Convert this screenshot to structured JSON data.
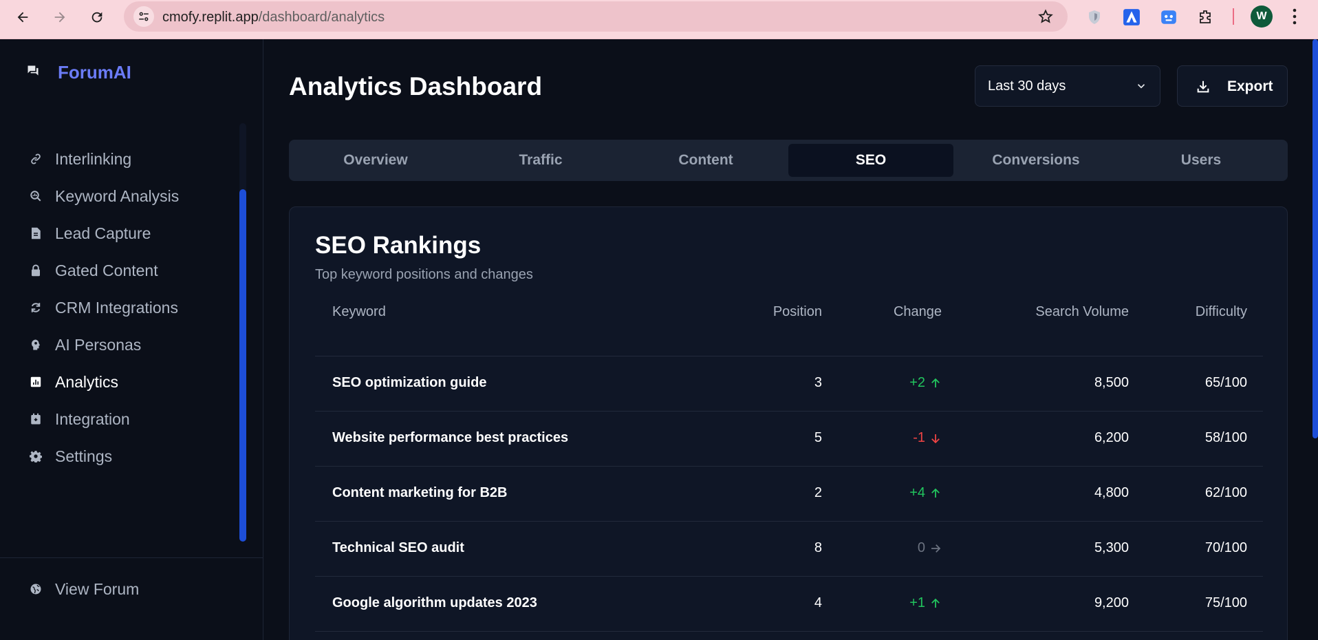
{
  "browser": {
    "url_host": "cmofy.replit.app",
    "url_path": "/dashboard/analytics",
    "profile_initial": "W"
  },
  "sidebar": {
    "brand": "ForumAI",
    "items": [
      {
        "label": "Interlinking",
        "icon": "link-icon"
      },
      {
        "label": "Keyword Analysis",
        "icon": "search-chart-icon"
      },
      {
        "label": "Lead Capture",
        "icon": "document-icon"
      },
      {
        "label": "Gated Content",
        "icon": "lock-icon"
      },
      {
        "label": "CRM Integrations",
        "icon": "sync-icon"
      },
      {
        "label": "AI Personas",
        "icon": "brain-icon"
      },
      {
        "label": "Analytics",
        "icon": "analytics-icon",
        "active": true
      },
      {
        "label": "Integration",
        "icon": "plug-icon"
      },
      {
        "label": "Settings",
        "icon": "gear-icon"
      }
    ],
    "footer": {
      "label": "View Forum",
      "icon": "globe-icon"
    }
  },
  "header": {
    "title": "Analytics Dashboard",
    "range": "Last 30 days",
    "export_label": "Export"
  },
  "tabs": [
    {
      "label": "Overview"
    },
    {
      "label": "Traffic"
    },
    {
      "label": "Content"
    },
    {
      "label": "SEO",
      "active": true
    },
    {
      "label": "Conversions"
    },
    {
      "label": "Users"
    }
  ],
  "seo": {
    "title": "SEO Rankings",
    "subtitle": "Top keyword positions and changes",
    "columns": [
      "Keyword",
      "Position",
      "Change",
      "Search Volume",
      "Difficulty"
    ],
    "rows": [
      {
        "keyword": "SEO optimization guide",
        "position": "3",
        "change": "+2",
        "trend": "up",
        "volume": "8,500",
        "difficulty": "65/100"
      },
      {
        "keyword": "Website performance best practices",
        "position": "5",
        "change": "-1",
        "trend": "down",
        "volume": "6,200",
        "difficulty": "58/100"
      },
      {
        "keyword": "Content marketing for B2B",
        "position": "2",
        "change": "+4",
        "trend": "up",
        "volume": "4,800",
        "difficulty": "62/100"
      },
      {
        "keyword": "Technical SEO audit",
        "position": "8",
        "change": "0",
        "trend": "flat",
        "volume": "5,300",
        "difficulty": "70/100"
      },
      {
        "keyword": "Google algorithm updates 2023",
        "position": "4",
        "change": "+1",
        "trend": "up",
        "volume": "9,200",
        "difficulty": "75/100"
      }
    ]
  },
  "colors": {
    "accent": "#6b7cf7",
    "positive": "#22c55e",
    "negative": "#ef4444",
    "neutral": "#6b7280"
  }
}
